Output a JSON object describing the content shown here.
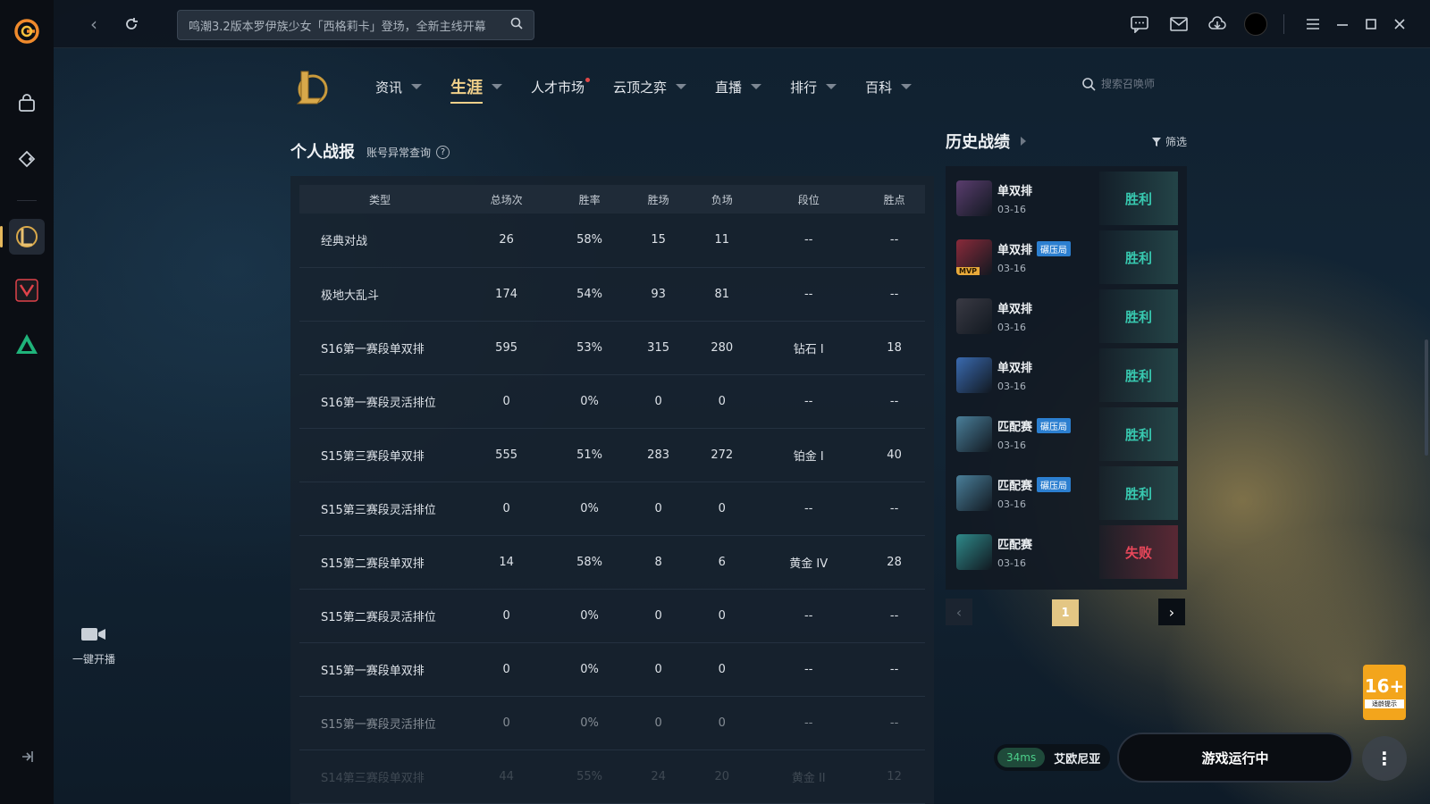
{
  "topbar": {
    "search_text": "鸣潮3.2版本罗伊族少女「西格莉卡」登场，全新主线开幕"
  },
  "lol_nav": {
    "items": [
      {
        "label": "资讯"
      },
      {
        "label": "生涯"
      },
      {
        "label": "人才市场"
      },
      {
        "label": "云顶之弈"
      },
      {
        "label": "直播"
      },
      {
        "label": "排行"
      },
      {
        "label": "百科"
      }
    ],
    "active": "生涯",
    "summoner_search_placeholder": "搜索召唤师"
  },
  "stats": {
    "title": "个人战报",
    "link": "账号异常查询",
    "columns": [
      "类型",
      "总场次",
      "胜率",
      "胜场",
      "负场",
      "段位",
      "胜点"
    ],
    "rows": [
      {
        "type": "经典对战",
        "total": "26",
        "winrate": "58%",
        "wins": "15",
        "losses": "11",
        "rank": "--",
        "lp": "--"
      },
      {
        "type": "极地大乱斗",
        "total": "174",
        "winrate": "54%",
        "wins": "93",
        "losses": "81",
        "rank": "--",
        "lp": "--"
      },
      {
        "type": "S16第一赛段单双排",
        "total": "595",
        "winrate": "53%",
        "wins": "315",
        "losses": "280",
        "rank": "钻石 I",
        "lp": "18"
      },
      {
        "type": "S16第一赛段灵活排位",
        "total": "0",
        "winrate": "0%",
        "wins": "0",
        "losses": "0",
        "rank": "--",
        "lp": "--"
      },
      {
        "type": "S15第三赛段单双排",
        "total": "555",
        "winrate": "51%",
        "wins": "283",
        "losses": "272",
        "rank": "铂金 I",
        "lp": "40"
      },
      {
        "type": "S15第三赛段灵活排位",
        "total": "0",
        "winrate": "0%",
        "wins": "0",
        "losses": "0",
        "rank": "--",
        "lp": "--"
      },
      {
        "type": "S15第二赛段单双排",
        "total": "14",
        "winrate": "58%",
        "wins": "8",
        "losses": "6",
        "rank": "黄金 IV",
        "lp": "28"
      },
      {
        "type": "S15第二赛段灵活排位",
        "total": "0",
        "winrate": "0%",
        "wins": "0",
        "losses": "0",
        "rank": "--",
        "lp": "--"
      },
      {
        "type": "S15第一赛段单双排",
        "total": "0",
        "winrate": "0%",
        "wins": "0",
        "losses": "0",
        "rank": "--",
        "lp": "--"
      },
      {
        "type": "S15第一赛段灵活排位",
        "total": "0",
        "winrate": "0%",
        "wins": "0",
        "losses": "0",
        "rank": "--",
        "lp": "--"
      },
      {
        "type": "S14第三赛段单双排",
        "total": "44",
        "winrate": "55%",
        "wins": "24",
        "losses": "20",
        "rank": "黄金 II",
        "lp": "12"
      }
    ]
  },
  "history": {
    "title": "历史战绩",
    "filter_label": "筛选",
    "matches": [
      {
        "mode": "单双排",
        "tag": "",
        "mvp": "",
        "date": "03-16",
        "result": "胜利",
        "outcome": "win",
        "color": "#5a3d6e"
      },
      {
        "mode": "单双排",
        "tag": "碾压局",
        "mvp": "MVP",
        "date": "03-16",
        "result": "胜利",
        "outcome": "win",
        "color": "#8a2a3a"
      },
      {
        "mode": "单双排",
        "tag": "",
        "mvp": "",
        "date": "03-16",
        "result": "胜利",
        "outcome": "win",
        "color": "#3a3a44"
      },
      {
        "mode": "单双排",
        "tag": "",
        "mvp": "",
        "date": "03-16",
        "result": "胜利",
        "outcome": "win",
        "color": "#3a6ab0"
      },
      {
        "mode": "匹配赛",
        "tag": "碾压局",
        "mvp": "",
        "date": "03-16",
        "result": "胜利",
        "outcome": "win",
        "color": "#4a7f9a"
      },
      {
        "mode": "匹配赛",
        "tag": "碾压局",
        "mvp": "",
        "date": "03-16",
        "result": "胜利",
        "outcome": "win",
        "color": "#4a7f9a"
      },
      {
        "mode": "匹配赛",
        "tag": "",
        "mvp": "",
        "date": "03-16",
        "result": "失败",
        "outcome": "loss",
        "color": "#2f8a8a"
      }
    ],
    "page": "1"
  },
  "bottom": {
    "live_label": "一键开播",
    "ping": "34ms",
    "region": "艾欧尼亚",
    "running_label": "游戏运行中",
    "age_rating": "16+",
    "age_sub": "适龄提示"
  },
  "colors": {
    "accent_gold": "#f1d08a",
    "win": "#38c9b0",
    "loss": "#e8475a"
  }
}
